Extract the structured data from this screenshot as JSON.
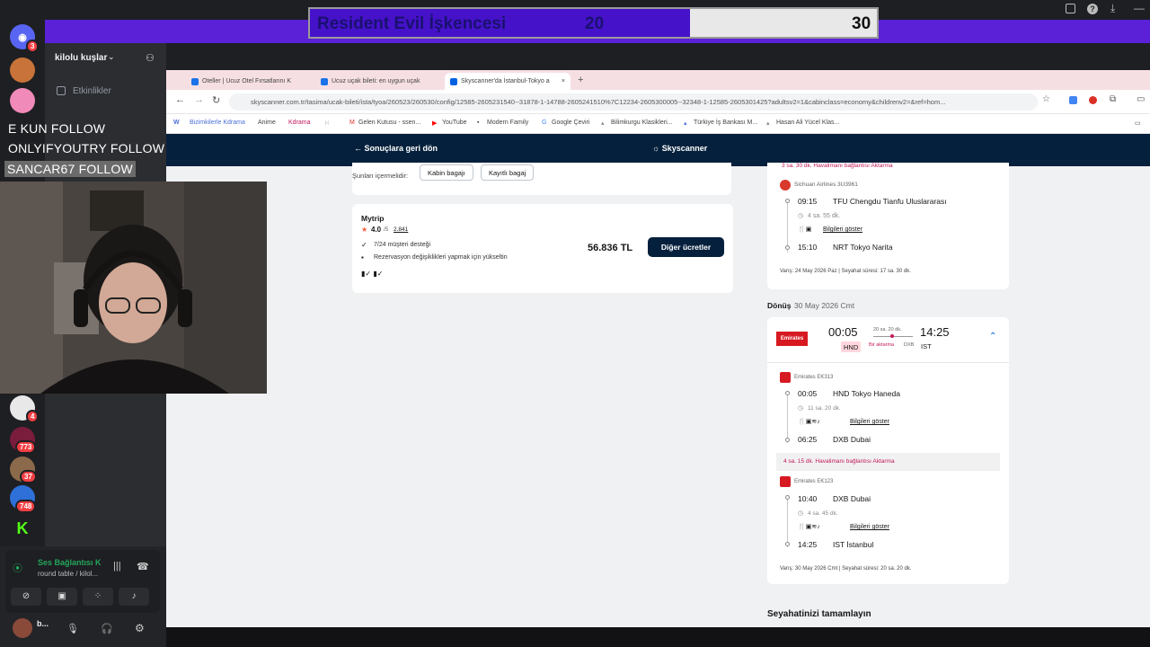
{
  "overlay": {
    "title": "Resident Evil İşkencesi",
    "score_left": "20",
    "score_right": "30",
    "follows": [
      "E KUN  FOLLOW",
      "ONLYIFYOUTRY  FOLLOW",
      "SANCAR67  FOLLOW"
    ]
  },
  "discord": {
    "server_name": "kilolu kuşlar",
    "events_label": "Etkinlikler",
    "badges": [
      "3",
      "4",
      "773",
      "37",
      "748"
    ],
    "voice_status": "Ses Bağlantısı K",
    "voice_channel": "round table / kilol...",
    "user_name": "b..."
  },
  "browser": {
    "tabs": [
      {
        "label": "Oteller | Ucuz Otel Fırsatlarını K"
      },
      {
        "label": "Ucuz uçak bileti: en uygun uçak"
      },
      {
        "label": "Skyscanner'da İstanbul-Tokyo a"
      }
    ],
    "url": "skyscanner.com.tr/tasima/ucak-bileti/ista/tyoa/260523/260530/config/12585-2605231540--31878-1-14788-2605241510%7C12234-2605300005--32348-1-12585-2605301425?adultsv2=1&cabinclass=economy&childrenv2=&ref=hom...",
    "bookmarks": [
      "Bizimkilerle Kdrama",
      "Anime",
      "Kdrama",
      "Gelen Kutusu - ssen...",
      "YouTube",
      "Modern Family",
      "Google Çeviri",
      "Bilimkurgu Klasikleri...",
      "Türkiye İş Bankası M...",
      "Hasan Ali Yücel Klas..."
    ]
  },
  "skyscanner": {
    "back_label": "Sonuçlara geri dön",
    "logo": "Skyscanner",
    "includes_label": "Şunları içermelidir:",
    "chip_cabin": "Kabin bagajı",
    "chip_checked": "Kayıtlı bagaj",
    "provider": {
      "name": "Mytrip",
      "rating": "4.0",
      "rating_max": "/5",
      "reviews": "2.841",
      "feature1": "7/24 müşteri desteği",
      "feature2": "Rezervasyon değişiklikleri yapmak için yükseltin",
      "price": "56.836 TL",
      "button": "Diğer ücretler"
    },
    "outbound": {
      "top_connection": "3 sa. 30 dk.  Havalimanı bağlantısı  Aktarma",
      "airline": "Sichuan Airlines 3U3961",
      "dep_time": "09:15",
      "dep_airport": "TFU Chengdu Tianfu Uluslararası",
      "duration": "4 sa. 55 dk.",
      "details": "Bilgileri göster",
      "arr_time": "15:10",
      "arr_airport": "NRT Tokyo Narita",
      "summary": "Varış: 24 May 2026 Paz  |  Seyahat süresi: 17 sa. 30 dk."
    },
    "return": {
      "label": "Dönüş",
      "date": "30 May 2026 Cmt",
      "airline_logo": "Emirates",
      "dep": "00:05",
      "arr": "14:25",
      "dep_code": "HND",
      "arr_code": "IST",
      "total_dur": "20 sa. 20 dk.",
      "stops": "Bir aktarma",
      "via": "DXB",
      "leg1": {
        "flight": "Emirates EK313",
        "dep_time": "00:05",
        "dep_airport": "HND Tokyo Haneda",
        "duration": "11 sa. 20 dk.",
        "details": "Bilgileri göster",
        "arr_time": "06:25",
        "arr_airport": "DXB Dubai"
      },
      "connection": "4 sa. 15 dk.  Havalimanı bağlantısı  Aktarma",
      "leg2": {
        "flight": "Emirates EK123",
        "dep_time": "10:40",
        "dep_airport": "DXB Dubai",
        "duration": "4 sa. 45 dk.",
        "details": "Bilgileri göster",
        "arr_time": "14:25",
        "arr_airport": "IST İstanbul"
      },
      "summary": "Varış: 30 May 2026 Cmt  |  Seyahat süresi: 20 sa. 20 dk."
    },
    "complete_label": "Seyahatinizi tamamlayın"
  }
}
